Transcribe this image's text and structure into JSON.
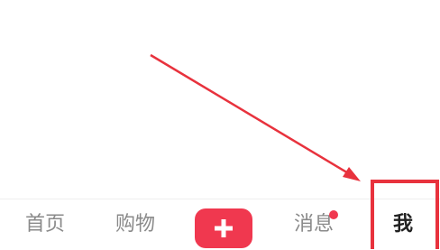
{
  "tabbar": {
    "home_label": "首页",
    "shop_label": "购物",
    "message_label": "消息",
    "me_label": "我",
    "add_icon": "plus-icon",
    "message_badge": "unread-dot",
    "accent_color": "#f0384f",
    "active_tab": "我"
  },
  "annotation": {
    "color": "#e8323d",
    "highlight": "我"
  }
}
